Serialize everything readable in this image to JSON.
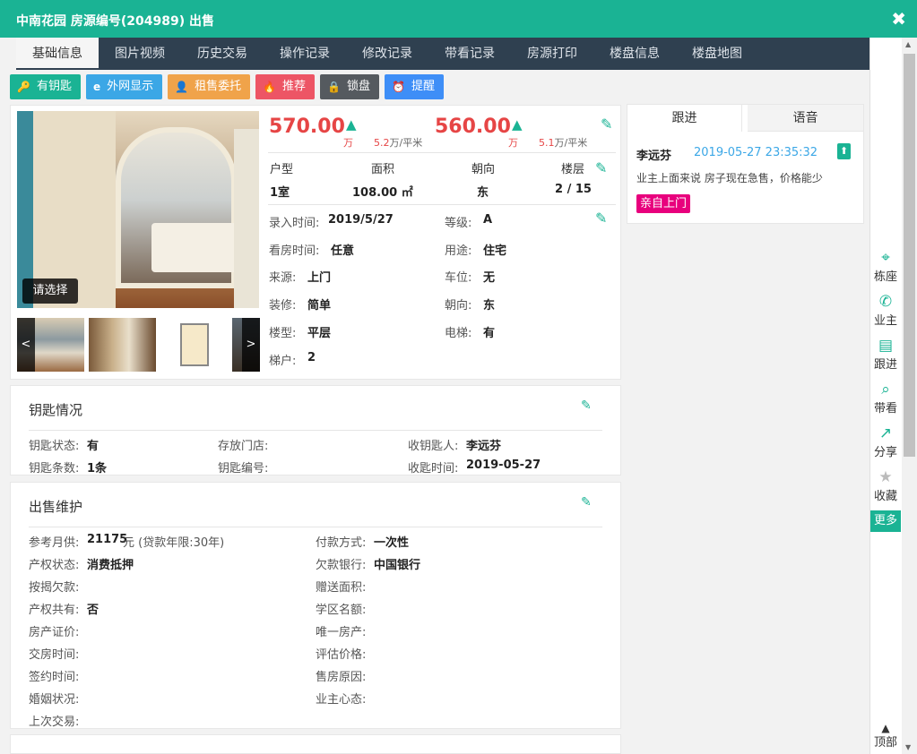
{
  "title": "中南花园 房源编号(204989) 出售",
  "close": "✖",
  "tabs": [
    "基础信息",
    "图片视频",
    "历史交易",
    "操作记录",
    "修改记录",
    "带看记录",
    "房源打印",
    "楼盘信息",
    "楼盘地图"
  ],
  "actions": [
    {
      "label": "有钥匙",
      "icon": "key-icon",
      "glyph": "🔑",
      "color": "#1ab394"
    },
    {
      "label": "外网显示",
      "icon": "browser-icon",
      "glyph": "e",
      "color": "#3ba7e6"
    },
    {
      "label": "租售委托",
      "icon": "user-icon",
      "glyph": "👤",
      "color": "#f0a34a"
    },
    {
      "label": "推荐",
      "icon": "fire-icon",
      "glyph": "🔥",
      "color": "#ed5565"
    },
    {
      "label": "锁盘",
      "icon": "lock-icon",
      "glyph": "🔒",
      "color": "#555a5f"
    },
    {
      "label": "提醒",
      "icon": "alarm-icon",
      "glyph": "⏰",
      "color": "#3e8ef7"
    }
  ],
  "photo": {
    "select_label": "请选择",
    "prev": "<",
    "next": ">"
  },
  "price": {
    "total": "570.00",
    "total_unit": "万",
    "total_per": "5.2",
    "per_unit": "万/平米",
    "base": "560.00",
    "base_unit": "万",
    "base_per": "5.1"
  },
  "specs": {
    "headers": [
      "户型",
      "面积",
      "朝向",
      "楼层"
    ],
    "values": [
      "1室",
      "108.00 ㎡",
      "东",
      "2 / 15"
    ]
  },
  "info": [
    {
      "l": "录入时间:",
      "v": "2019/5/27"
    },
    {
      "l": "等级:",
      "v": "A"
    },
    {
      "l": "看房时间:",
      "v": "任意"
    },
    {
      "l": "用途:",
      "v": "住宅"
    },
    {
      "l": "来源:",
      "v": "上门"
    },
    {
      "l": "车位:",
      "v": "无"
    },
    {
      "l": "装修:",
      "v": "简单"
    },
    {
      "l": "朝向:",
      "v": "东"
    },
    {
      "l": "楼型:",
      "v": "平层"
    },
    {
      "l": "电梯:",
      "v": "有"
    },
    {
      "l": "梯户:",
      "v": "2"
    }
  ],
  "keys": {
    "title": "钥匙情况",
    "rows": [
      {
        "l": "钥匙状态:",
        "v": "有"
      },
      {
        "l": "存放门店:",
        "v": ""
      },
      {
        "l": "收钥匙人:",
        "v": "李远芬"
      },
      {
        "l": "钥匙条数:",
        "v": "1条"
      },
      {
        "l": "钥匙编号:",
        "v": ""
      },
      {
        "l": "收匙时间:",
        "v": "2019-05-27"
      }
    ]
  },
  "sale": {
    "title": "出售维护",
    "rows": [
      {
        "l": "参考月供:",
        "v": "21175",
        "extra": "元 (贷款年限:30年)"
      },
      {
        "l": "付款方式:",
        "v": "一次性"
      },
      {
        "l": "产权状态:",
        "v": "消费抵押"
      },
      {
        "l": "欠款银行:",
        "v": "中国银行"
      },
      {
        "l": "按揭欠款:",
        "v": ""
      },
      {
        "l": "赠送面积:",
        "v": ""
      },
      {
        "l": "产权共有:",
        "v": "否"
      },
      {
        "l": "学区名额:",
        "v": ""
      },
      {
        "l": "房产证价:",
        "v": ""
      },
      {
        "l": "唯一房产:",
        "v": ""
      },
      {
        "l": "交房时间:",
        "v": ""
      },
      {
        "l": "评估价格:",
        "v": ""
      },
      {
        "l": "签约时间:",
        "v": ""
      },
      {
        "l": "售房原因:",
        "v": ""
      },
      {
        "l": "婚姻状况:",
        "v": ""
      },
      {
        "l": "业主心态:",
        "v": ""
      },
      {
        "l": "上次交易:",
        "v": ""
      }
    ]
  },
  "follow": {
    "tabs": [
      "跟进",
      "语音"
    ],
    "name": "李远芬",
    "time": "2019-05-27 23:35:32",
    "text": "业主上面来说 房子现在急售，价格能少",
    "tag": "亲自上门"
  },
  "sidebar": [
    {
      "label": "栋座",
      "icon": "location-pin-icon",
      "glyph": "📍"
    },
    {
      "label": "业主",
      "icon": "phone-icon",
      "glyph": "📞"
    },
    {
      "label": "跟进",
      "icon": "document-icon",
      "glyph": "📋"
    },
    {
      "label": "带看",
      "icon": "search-doc-icon",
      "glyph": "🔍"
    },
    {
      "label": "分享",
      "icon": "share-icon",
      "glyph": "↗"
    },
    {
      "label": "收藏",
      "icon": "star-icon",
      "glyph": "★"
    }
  ],
  "more": "更多",
  "top": "顶部",
  "colors": {
    "accent": "#1ab394",
    "price": "#e64545",
    "tabbar": "#2f4050",
    "tag": "#e8007d"
  }
}
